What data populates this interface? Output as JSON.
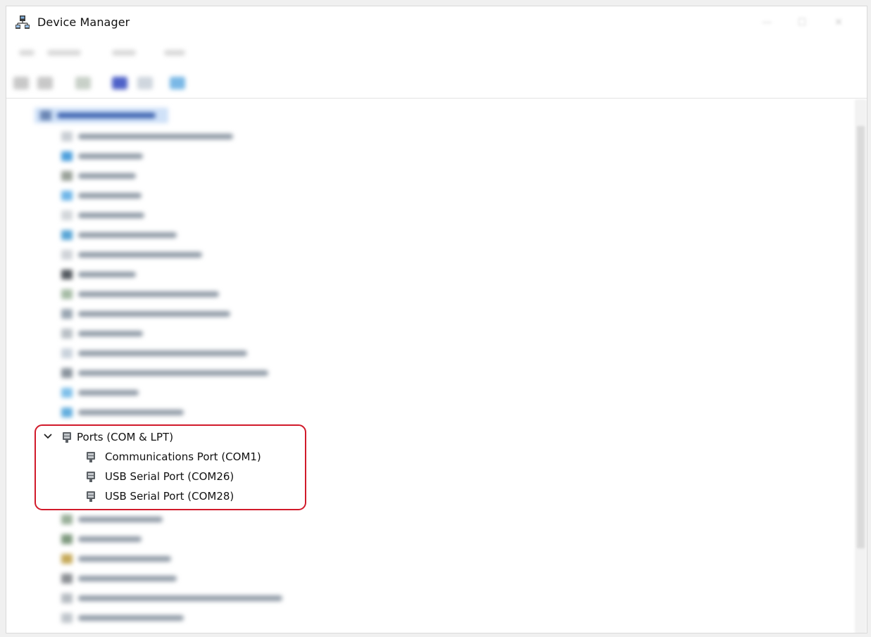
{
  "window": {
    "title": "Device Manager",
    "icon": "device-manager-icon"
  },
  "tree": {
    "expanded_category": {
      "label": "Ports (COM & LPT)",
      "icon": "port-connector-icon",
      "expanded": true,
      "children": [
        {
          "label": "Communications Port (COM1)",
          "icon": "port-connector-icon"
        },
        {
          "label": "USB Serial Port (COM26)",
          "icon": "port-connector-icon"
        },
        {
          "label": "USB Serial Port (COM28)",
          "icon": "port-connector-icon"
        }
      ]
    }
  },
  "colors": {
    "highlight_border": "#d11a2a",
    "selection": "#cfe1f8"
  }
}
